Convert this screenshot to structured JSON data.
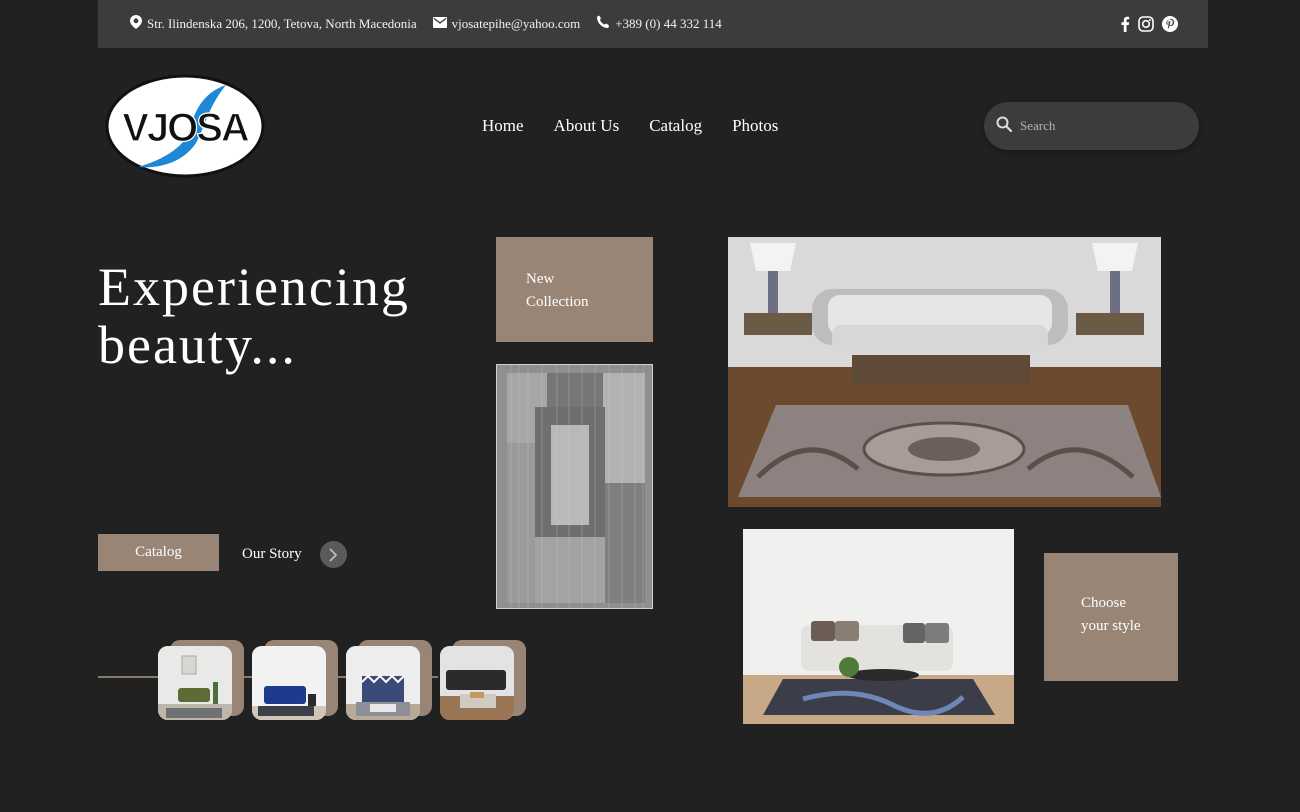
{
  "topbar": {
    "address": "Str. Ilindenska 206, 1200, Tetova, North Macedonia",
    "email": "vjosatepihe@yahoo.com",
    "phone": "+389 (0) 44 332 114",
    "social_icons": [
      "facebook-icon",
      "instagram-icon",
      "pinterest-icon"
    ]
  },
  "logo": {
    "text": "VJOSA"
  },
  "nav": {
    "items": [
      {
        "label": "Home"
      },
      {
        "label": "About Us"
      },
      {
        "label": "Catalog"
      },
      {
        "label": "Photos"
      }
    ]
  },
  "search": {
    "placeholder": "Search"
  },
  "hero": {
    "title_line1": "Experiencing",
    "title_line2": "beauty...",
    "catalog_button": "Catalog",
    "story_link": "Our Story"
  },
  "cards": {
    "new_collection_line1": "New",
    "new_collection_line2": "Collection",
    "choose_style_line1": "Choose",
    "choose_style_line2": "your style"
  },
  "colors": {
    "background": "#212121",
    "topbar": "#3c3c3c",
    "accent": "#998575",
    "logo_blue": "#1e88d6"
  }
}
